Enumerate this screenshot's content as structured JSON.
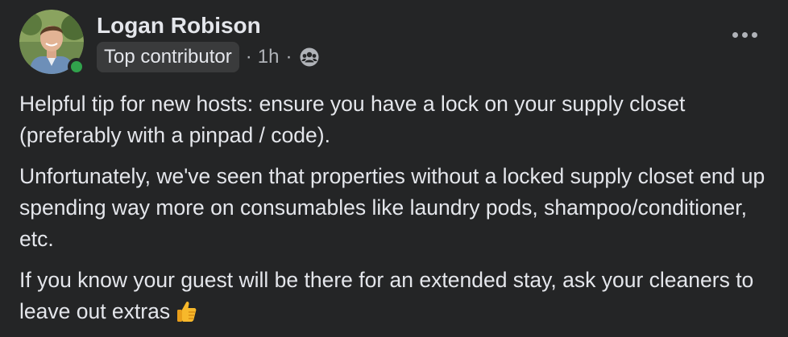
{
  "post": {
    "author": "Logan Robison",
    "badge": "Top contributor",
    "separator1": "·",
    "time": "1h",
    "separator2": "·",
    "audience_icon": "group-icon",
    "more_icon": "more-horizontal-icon",
    "paragraphs": [
      "Helpful tip for new hosts: ensure you have a lock on your supply closet (preferably with a pinpad / code).",
      "Unfortunately, we've seen that properties without a locked supply closet end up spending way more on consumables like laundry pods, shampoo/conditioner, etc.",
      "If you know your guest will be there for an extended stay, ask your cleaners to leave out extras"
    ],
    "emoji": "thumbs-up-emoji"
  },
  "colors": {
    "background": "#242526",
    "text_primary": "#e4e6eb",
    "text_secondary": "#b0b3b8",
    "badge_bg": "#3a3b3c",
    "online": "#31a24c"
  }
}
